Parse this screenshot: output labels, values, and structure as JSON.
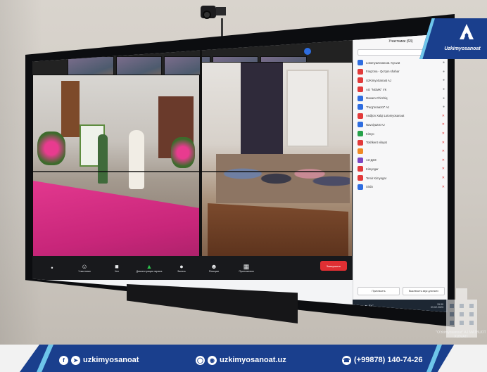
{
  "zoom": {
    "participants_title": "Участники (63)",
    "participants": [
      {
        "initials": "LC",
        "name": "Lotomyazosanoat. Kyuvat",
        "color": "#2e6de0",
        "muted": false
      },
      {
        "initials": "",
        "name": "Farg'ona - Qo'qon shahar",
        "color": "#e23a3a",
        "muted": false
      },
      {
        "initials": "",
        "name": "UzKimyoSanoat AJ",
        "color": "#e23a3a",
        "muted": false
      },
      {
        "initials": "",
        "name": "AO \"NGMK\" УК",
        "color": "#e23a3a",
        "muted": false
      },
      {
        "initials": "",
        "name": "Maxam-Chirchiq",
        "color": "#2e6de0",
        "muted": false
      },
      {
        "initials": "",
        "name": "\"Farg'onaazot\" AJ",
        "color": "#2e6de0",
        "muted": false
      },
      {
        "initials": "",
        "name": "Andijon Xalqi Lotomyosanoat",
        "color": "#e23a3a",
        "muted": true
      },
      {
        "initials": "",
        "name": "Navoiyazot AJ",
        "color": "#2e6de0",
        "muted": true
      },
      {
        "initials": "",
        "name": "Kimyo",
        "color": "#27a24b",
        "muted": true
      },
      {
        "initials": "",
        "name": "Toshkent viloyat",
        "color": "#e23a3a",
        "muted": true
      },
      {
        "initials": "",
        "name": "",
        "color": "#f08a24",
        "muted": true
      },
      {
        "initials": "",
        "name": "AЗ-ДЗЗ",
        "color": "#7b46c2",
        "muted": true
      },
      {
        "initials": "",
        "name": "Kimyogar",
        "color": "#e23a3a",
        "muted": true
      },
      {
        "initials": "",
        "name": "Temir Kimyogar",
        "color": "#e23a3a",
        "muted": true
      },
      {
        "initials": "",
        "name": "Sirdo",
        "color": "#2e6de0",
        "muted": true
      }
    ],
    "footer_buttons": [
      "Пригласить",
      "Выключить звук для всех"
    ],
    "toolbar": [
      {
        "icon": "mic-icon",
        "glyph": "•",
        "label": "",
        "green": false
      },
      {
        "icon": "participants-icon",
        "glyph": "☺",
        "label": "Участники",
        "green": false
      },
      {
        "icon": "chat-icon",
        "glyph": "■",
        "label": "Чат",
        "green": false
      },
      {
        "icon": "share-screen-icon",
        "glyph": "▲",
        "label": "Демонстрация экрана",
        "green": true
      },
      {
        "icon": "record-icon",
        "glyph": "●",
        "label": "Запись",
        "green": false
      },
      {
        "icon": "reactions-icon",
        "glyph": "☻",
        "label": "Реакции",
        "green": false
      },
      {
        "icon": "apps-icon",
        "glyph": "▦",
        "label": "Приложения",
        "green": false
      }
    ],
    "end_button": "Завершить",
    "taskbar_time": "15:30",
    "taskbar_date": "09.02.2023",
    "taskbar_lang": "РУС"
  },
  "branding": {
    "logo_text": "Uzkimyosanoat",
    "watermark_text": "\"O'zkimyosanoat\" AJ MATBUOT XIZMATI",
    "accent": "#1a3f8d",
    "stripe": "#6ec6ea"
  },
  "footer": {
    "social": "uzkimyosanoat",
    "website": "uzkimyosanoat.uz",
    "phone": "(+99878) 140-74-26"
  }
}
